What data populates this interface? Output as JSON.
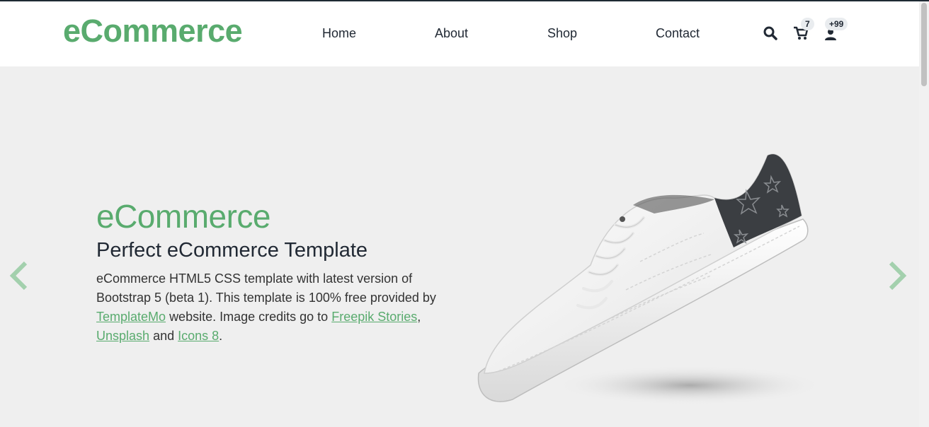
{
  "header": {
    "brand": "eCommerce",
    "nav": [
      {
        "label": "Home"
      },
      {
        "label": "About"
      },
      {
        "label": "Shop"
      },
      {
        "label": "Contact"
      }
    ],
    "icons": {
      "search": "search-icon",
      "cart": "cart-icon",
      "user": "user-icon"
    },
    "cart_badge": "7",
    "user_badge": "+99"
  },
  "hero": {
    "brand": "eCommerce",
    "title": "Perfect eCommerce Template",
    "text_1": "eCommerce HTML5 CSS template with latest version of Bootstrap 5 (beta 1). This template is 100% free provided by",
    "link_templatemo": "TemplateMo",
    "text_2": "website. Image credits go to",
    "link_freepik": "Freepik Stories",
    "text_3": ",",
    "link_unsplash": "Unsplash",
    "text_4": "and",
    "link_icons8": "Icons 8",
    "text_5": "."
  },
  "colors": {
    "brand_green": "#59ab6e",
    "hero_bg": "#efefef",
    "text_dark": "#212934"
  }
}
